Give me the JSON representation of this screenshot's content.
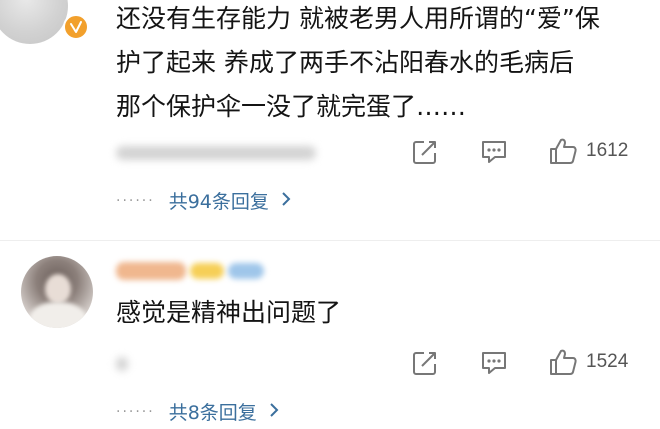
{
  "comments": [
    {
      "text_lines": [
        "还没有生存能力 就被老男人用所谓的“爱”保",
        "护了起来 养成了两手不沾阳春水的毛病后",
        "那个保护伞一没了就完蛋了……"
      ],
      "likes": "1612",
      "replies_label": "共94条回复",
      "avatar_badge": "v-badge-icon"
    },
    {
      "text_lines": [
        "感觉是精神出问题了"
      ],
      "likes": "1524",
      "replies_label": "共8条回复"
    }
  ],
  "icons": {
    "share": "share-icon",
    "comment": "comment-icon",
    "like": "thumbs-up-icon",
    "replies_arrow": "chevron-right-icon"
  },
  "colors": {
    "reply_link": "#3b6f9d",
    "badge": "#f2a02c",
    "text": "#141414",
    "muted": "#555555"
  }
}
